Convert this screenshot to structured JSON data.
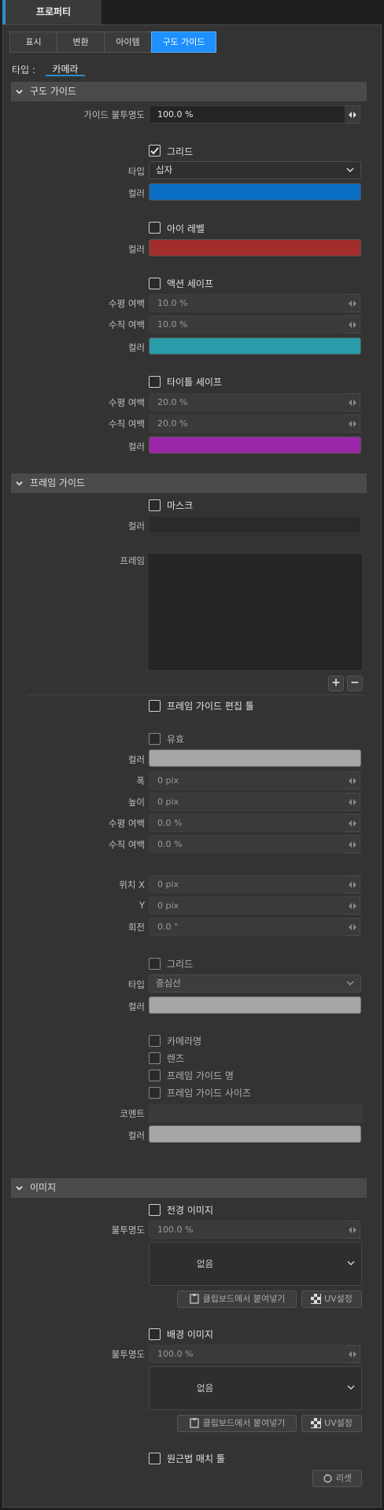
{
  "window": {
    "tab_title": "프로퍼티"
  },
  "subtabs": [
    "표시",
    "변환",
    "아이템",
    "구도 가이드"
  ],
  "type_row": {
    "label": "타입  :",
    "value": "카메라"
  },
  "sections": {
    "composition": "구도 가이드",
    "frame": "프레임 가이드",
    "image": "이미지"
  },
  "composition": {
    "guide_opacity_label": "가이드 불투명도",
    "guide_opacity_value": "100.0 %",
    "grid_label": "그리드",
    "grid_checked": true,
    "grid_type_label": "타입",
    "grid_type_value": "십자",
    "grid_color_label": "컬러",
    "grid_color": "#0a6fc2",
    "eye_level_label": "아이 레벨",
    "eye_level_color_label": "컬러",
    "eye_level_color": "#a22d2d",
    "action_safe_label": "액션 세이프",
    "action_h_label": "수평 여백",
    "action_h_value": "10.0 %",
    "action_v_label": "수직 여백",
    "action_v_value": "10.0 %",
    "action_color_label": "컬러",
    "action_color": "#2a9ba8",
    "title_safe_label": "타이틀 세이프",
    "title_h_label": "수평 여백",
    "title_h_value": "20.0 %",
    "title_v_label": "수직 여백",
    "title_v_value": "20.0 %",
    "title_color_label": "컬러",
    "title_color": "#9b27a8"
  },
  "frame": {
    "mask_label": "마스크",
    "mask_color_label": "컬러",
    "frame_label": "프레임",
    "add_label": "+",
    "remove_label": "−",
    "edit_tool_label": "프레임 가이드 편집 툴",
    "valid_label": "유효",
    "color_label": "컬러",
    "width_label": "폭",
    "width_value": "0 pix",
    "height_label": "높이",
    "height_value": "0 pix",
    "h_margin_label": "수평 여백",
    "h_margin_value": "0.0 %",
    "v_margin_label": "수직 여백",
    "v_margin_value": "0.0 %",
    "pos_x_label": "위치 X",
    "pos_x_value": "0 pix",
    "pos_y_label": "Y",
    "pos_y_value": "0 pix",
    "rotation_label": "회전",
    "rotation_value": "0.0 °",
    "grid_label": "그리드",
    "grid_type_label": "타입",
    "grid_type_value": "중심선",
    "grid_color_label": "컬러",
    "camera_name_label": "카메라명",
    "lens_label": "렌즈",
    "frame_guide_name_label": "프레임 가이드 명",
    "frame_guide_size_label": "프레임 가이드 사이즈",
    "comment_label": "코멘트",
    "comment_value": "",
    "text_color_label": "컬러",
    "light_color": "#a6a6a6"
  },
  "image": {
    "fg_label": "전경 이미지",
    "fg_opacity_label": "불투명도",
    "fg_opacity_value": "100.0 %",
    "fg_source": "없음",
    "paste_label": "클립보드에서 붙여넣기",
    "uv_label": "UV설정",
    "bg_label": "배경 이미지",
    "bg_opacity_label": "불투명도",
    "bg_opacity_value": "100.0 %",
    "bg_source": "없음",
    "perspective_label": "원근법 매치 툴",
    "reset_label": "리셋"
  },
  "icons": [
    "chevron-down-icon",
    "checkmark-icon",
    "spinner-arrows-icon",
    "clipboard-icon",
    "checker-icon",
    "reset-icon"
  ]
}
